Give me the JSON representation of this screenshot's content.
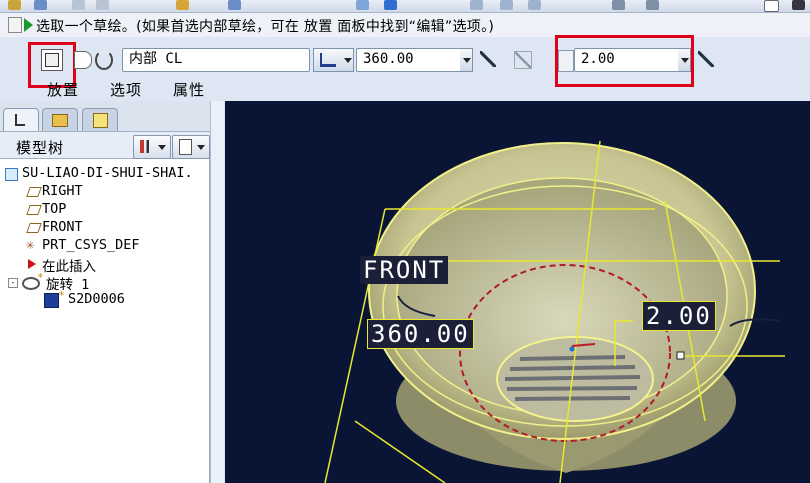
{
  "message": {
    "text": "选取一个草绘。(如果首选内部草绘，可在 放置 面板中找到“编辑”选项。)"
  },
  "dashboard": {
    "sketch_field_value": "内部 CL",
    "angle_value": "360.00",
    "thickness_value": "2.00",
    "tabs": [
      {
        "label": "放置"
      },
      {
        "label": "选项"
      },
      {
        "label": "属性"
      }
    ]
  },
  "navigator": {
    "tree_title": "模型树",
    "items": [
      {
        "label": "SU-LIAO-DI-SHUI-SHAI."
      },
      {
        "label": "RIGHT"
      },
      {
        "label": "TOP"
      },
      {
        "label": "FRONT"
      },
      {
        "label": "PRT_CSYS_DEF"
      },
      {
        "label": "在此插入"
      },
      {
        "label": "旋转 1"
      },
      {
        "label": "S2D0006"
      }
    ]
  },
  "viewport": {
    "front_label": "FRONT",
    "angle_dim": "360.00",
    "thickness_dim": "2.00"
  }
}
